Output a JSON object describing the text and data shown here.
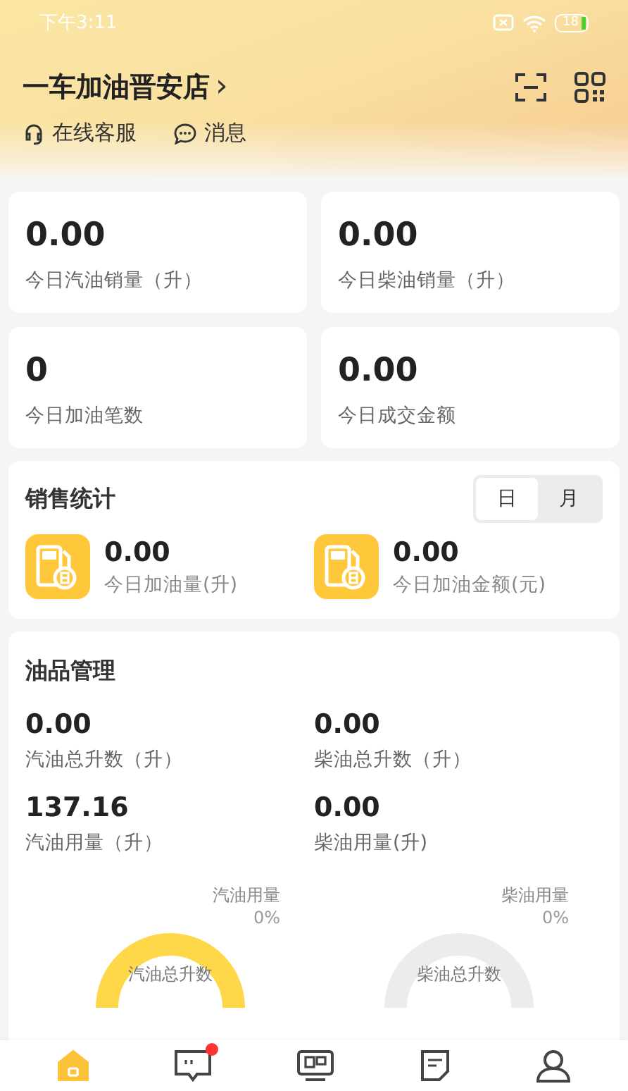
{
  "status_bar": {
    "time": "下午3:11",
    "battery": "18"
  },
  "header": {
    "store": "一车加油晋安店",
    "chevron": "›",
    "links": [
      {
        "kind": "service",
        "label": "在线客服"
      },
      {
        "kind": "message",
        "label": "消息"
      }
    ]
  },
  "stats": [
    {
      "value": "0.00",
      "label": "今日汽油销量（升）"
    },
    {
      "value": "0.00",
      "label": "今日柴油销量（升）"
    },
    {
      "value": "0",
      "label": "今日加油笔数"
    },
    {
      "value": "0.00",
      "label": "今日成交金额"
    }
  ],
  "sales": {
    "title": "销售统计",
    "periods": [
      {
        "label": "日",
        "selected": true
      },
      {
        "label": "月",
        "selected": false
      }
    ],
    "items": [
      {
        "value": "0.00",
        "label": "今日加油量(升)"
      },
      {
        "value": "0.00",
        "label": "今日加油金额(元)"
      }
    ]
  },
  "oil": {
    "title": "油品管理",
    "items": [
      {
        "value": "0.00",
        "label": "汽油总升数（升）"
      },
      {
        "value": "0.00",
        "label": "柴油总升数（升）"
      },
      {
        "value": "137.16",
        "label": "汽油用量（升）"
      },
      {
        "value": "0.00",
        "label": "柴油用量(升)"
      }
    ],
    "gauges": [
      {
        "name": "汽油用量",
        "percent": "0%",
        "center": "汽油总升数",
        "color": "#ffd84a"
      },
      {
        "name": "柴油用量",
        "percent": "0%",
        "center": "柴油总升数",
        "color": "#ececec"
      }
    ]
  },
  "nav": [
    {
      "kind": "home",
      "selected": true,
      "badge": false
    },
    {
      "kind": "message",
      "selected": false,
      "badge": true
    },
    {
      "kind": "monitor",
      "selected": false,
      "badge": false
    },
    {
      "kind": "notes",
      "selected": false,
      "badge": false
    },
    {
      "kind": "profile",
      "selected": false,
      "badge": false
    }
  ]
}
